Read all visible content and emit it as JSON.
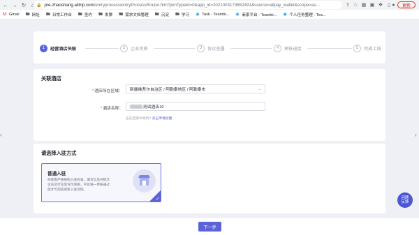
{
  "browser": {
    "url_main": "pre-zhaoshang.alitrip.com",
    "url_rest": "/entryprocess/entryProcessRouter.htm?joinTypeId=0&app_id=2021003173652491&source=alipay_wallet&scope=au...",
    "update_label": "更新",
    "bookmarks": [
      {
        "label": "Gmail",
        "icon": "gmail-icon"
      },
      {
        "label": "网址",
        "icon": "folder-icon"
      },
      {
        "label": "日常工作台",
        "icon": "folder-icon"
      },
      {
        "label": "签约",
        "icon": "folder-icon"
      },
      {
        "label": "发票",
        "icon": "folder-icon"
      },
      {
        "label": "需求文档管理",
        "icon": "folder-icon"
      },
      {
        "label": "沉淀",
        "icon": "folder-icon"
      },
      {
        "label": "学习",
        "icon": "folder-icon"
      },
      {
        "label": "Task - Teambi...",
        "icon": "teambition-icon"
      },
      {
        "label": "商家平台 - Teambi...",
        "icon": "teambition-icon"
      },
      {
        "label": "个人任务整理 · Tea...",
        "icon": "teambition-icon"
      }
    ]
  },
  "steps": [
    {
      "num": "1",
      "label": "经营酒店关联",
      "state": "active"
    },
    {
      "num": "2",
      "label": "企业资质",
      "state": "todo"
    },
    {
      "num": "3",
      "label": "协议签署",
      "state": "todo"
    },
    {
      "num": "4",
      "label": "审核进度",
      "state": "todo"
    },
    {
      "num": "5",
      "label": "完成上线",
      "state": "todo"
    }
  ],
  "hotel_section": {
    "title": "关联酒店",
    "region_label": "酒店所在区域：",
    "region_value": "新疆维吾尔自治区 / 阿勒泰地区 / 阿勒泰市",
    "name_label": "酒店名称：",
    "name_value": "测试酒店10",
    "hint_text": "名在检索中找到?",
    "hint_link": "点击申请创建"
  },
  "mode_section": {
    "title": "请选择入驻方式",
    "option_title": "普通入驻",
    "option_desc": [
      "商家需严格按照入驻标准，填写信息并提交",
      "企业及行业等许可资质，平台进一审核通过",
      "后才可完成商家入驻流程。"
    ]
  },
  "footer": {
    "next_label": "下一步"
  },
  "feedback": {
    "line1": "问题",
    "line2": "反馈"
  },
  "colors": {
    "accent": "#5b63d6",
    "page_bg": "#eef0f5",
    "required": "#e34d59"
  }
}
